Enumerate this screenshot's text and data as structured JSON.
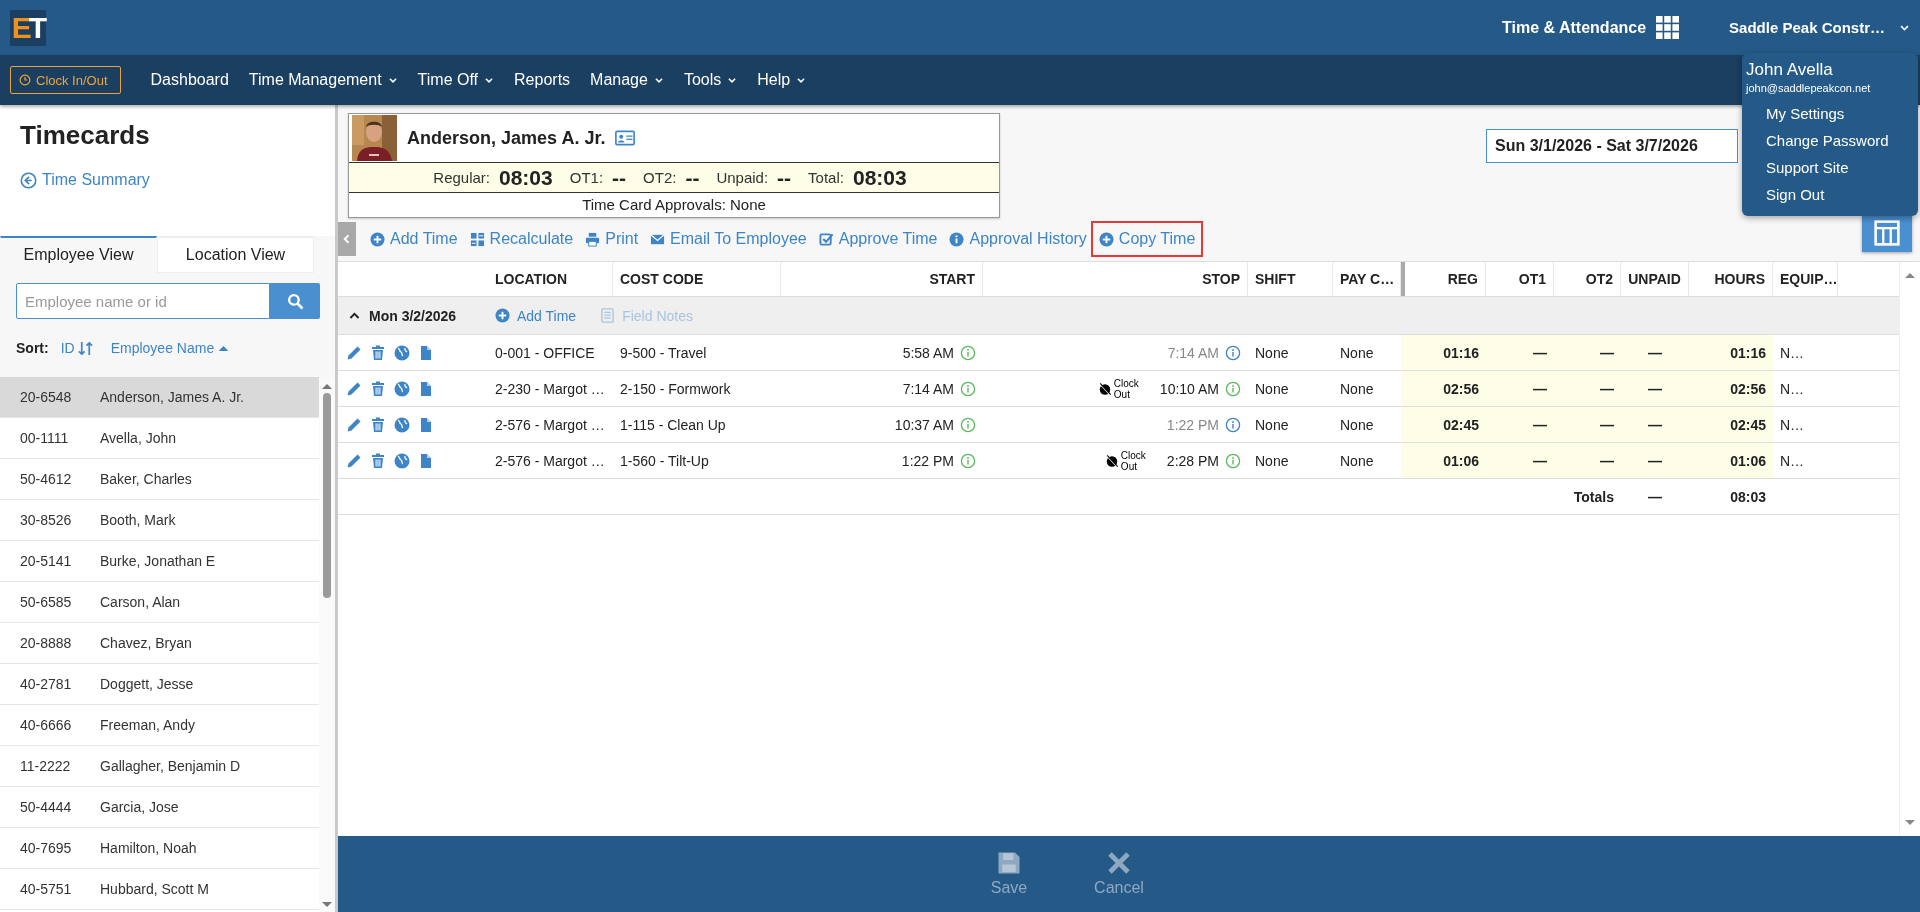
{
  "app": {
    "logo": "ET",
    "product": "Time & Attendance",
    "company": "Saddle Peak Constr…"
  },
  "nav": {
    "clock_button": "Clock In/Out",
    "items": [
      {
        "label": "Dashboard",
        "dropdown": false
      },
      {
        "label": "Time Management",
        "dropdown": true
      },
      {
        "label": "Time Off",
        "dropdown": true
      },
      {
        "label": "Reports",
        "dropdown": false
      },
      {
        "label": "Manage",
        "dropdown": true
      },
      {
        "label": "Tools",
        "dropdown": true
      },
      {
        "label": "Help",
        "dropdown": true
      }
    ]
  },
  "user_menu": {
    "name": "John Avella",
    "email": "john@saddlepeakcon.net",
    "items": [
      "My Settings",
      "Change Password",
      "Support Site",
      "Sign Out"
    ]
  },
  "sidebar": {
    "title": "Timecards",
    "back_link": "Time Summary",
    "tabs": [
      {
        "label": "Employee View",
        "selected": true
      },
      {
        "label": "Location View",
        "selected": false
      }
    ],
    "search": {
      "placeholder": "Employee name or id"
    },
    "sort": {
      "label": "Sort:",
      "options": [
        {
          "label": "ID",
          "kind": "toggle"
        },
        {
          "label": "Employee Name",
          "kind": "ascending"
        }
      ]
    },
    "employees": [
      {
        "id": "20-6548",
        "name": "Anderson, James A. Jr.",
        "selected": true
      },
      {
        "id": "00-1111",
        "name": "Avella, John",
        "selected": false
      },
      {
        "id": "50-4612",
        "name": "Baker, Charles",
        "selected": false
      },
      {
        "id": "30-8526",
        "name": "Booth, Mark",
        "selected": false
      },
      {
        "id": "20-5141",
        "name": "Burke, Jonathan E",
        "selected": false
      },
      {
        "id": "50-6585",
        "name": "Carson, Alan",
        "selected": false
      },
      {
        "id": "20-8888",
        "name": "Chavez, Bryan",
        "selected": false
      },
      {
        "id": "40-2781",
        "name": "Doggett, Jesse",
        "selected": false
      },
      {
        "id": "40-6666",
        "name": "Freeman, Andy",
        "selected": false
      },
      {
        "id": "11-2222",
        "name": "Gallagher, Benjamin D",
        "selected": false
      },
      {
        "id": "50-4444",
        "name": "Garcia, Jose",
        "selected": false
      },
      {
        "id": "40-7695",
        "name": "Hamilton, Noah",
        "selected": false
      },
      {
        "id": "40-5751",
        "name": "Hubbard, Scott M",
        "selected": false
      }
    ]
  },
  "employee_card": {
    "name": "Anderson, James A. Jr.",
    "summary": [
      {
        "label": "Regular:",
        "value": "08:03"
      },
      {
        "label": "OT1:",
        "value": "--"
      },
      {
        "label": "OT2:",
        "value": "--"
      },
      {
        "label": "Unpaid:",
        "value": "--"
      },
      {
        "label": "Total:",
        "value": "08:03"
      }
    ],
    "approvals": "Time Card Approvals: None"
  },
  "date_range": "Sun 3/1/2026 - Sat 3/7/2026",
  "toolbar": [
    {
      "label": "Add Time",
      "kind": "plus",
      "highlighted": false
    },
    {
      "label": "Recalculate",
      "kind": "calculator",
      "highlighted": false
    },
    {
      "label": "Print",
      "kind": "printer",
      "highlighted": false
    },
    {
      "label": "Email To Employee",
      "kind": "envelope",
      "highlighted": false
    },
    {
      "label": "Approve Time",
      "kind": "check",
      "highlighted": false
    },
    {
      "label": "Approval History",
      "kind": "info",
      "highlighted": false
    },
    {
      "label": "Copy Time",
      "kind": "plus",
      "highlighted": true
    }
  ],
  "table": {
    "columns": [
      "LOCATION",
      "COST CODE",
      "START",
      "STOP",
      "SHIFT",
      "PAY C…",
      "REG",
      "OT1",
      "OT2",
      "UNPAID",
      "HOURS",
      "EQUIP…"
    ],
    "day": {
      "label": "Mon 3/2/2026",
      "expanded": true,
      "actions": [
        {
          "label": "Add Time",
          "kind": "plus",
          "disabled": false
        },
        {
          "label": "Field Notes",
          "kind": "notes",
          "disabled": true
        }
      ]
    },
    "rows": [
      {
        "location": "0-001 - OFFICE",
        "cost_code": "9-500 - Travel",
        "start": "5:58 AM",
        "stop": "7:14 AM",
        "clock_out": false,
        "shift": "None",
        "pay_code": "None",
        "reg": "01:16",
        "ot1": "—",
        "ot2": "—",
        "unpaid": "—",
        "hours": "01:16",
        "equipment": "N…"
      },
      {
        "location": "2-230 - Margot …",
        "cost_code": "2-150 - Formwork",
        "start": "7:14 AM",
        "stop": "10:10 AM",
        "clock_out": true,
        "clock_out_label": "Clock Out",
        "shift": "None",
        "pay_code": "None",
        "reg": "02:56",
        "ot1": "—",
        "ot2": "—",
        "unpaid": "—",
        "hours": "02:56",
        "equipment": "N…"
      },
      {
        "location": "2-576 - Margot …",
        "cost_code": "1-115 - Clean Up",
        "start": "10:37 AM",
        "stop": "1:22 PM",
        "clock_out": false,
        "shift": "None",
        "pay_code": "None",
        "reg": "02:45",
        "ot1": "—",
        "ot2": "—",
        "unpaid": "—",
        "hours": "02:45",
        "equipment": "N…"
      },
      {
        "location": "2-576 - Margot …",
        "cost_code": "1-560 - Tilt-Up",
        "start": "1:22 PM",
        "stop": "2:28 PM",
        "clock_out": true,
        "clock_out_label": "Clock Out",
        "shift": "None",
        "pay_code": "None",
        "reg": "01:06",
        "ot1": "—",
        "ot2": "—",
        "unpaid": "—",
        "hours": "01:06",
        "equipment": "N…"
      }
    ],
    "totals": {
      "label": "Totals",
      "unpaid": "—",
      "hours": "08:03"
    }
  },
  "footer": [
    {
      "label": "Save",
      "kind": "save",
      "disabled": true
    },
    {
      "label": "Cancel",
      "kind": "cancel",
      "disabled": true
    }
  ]
}
